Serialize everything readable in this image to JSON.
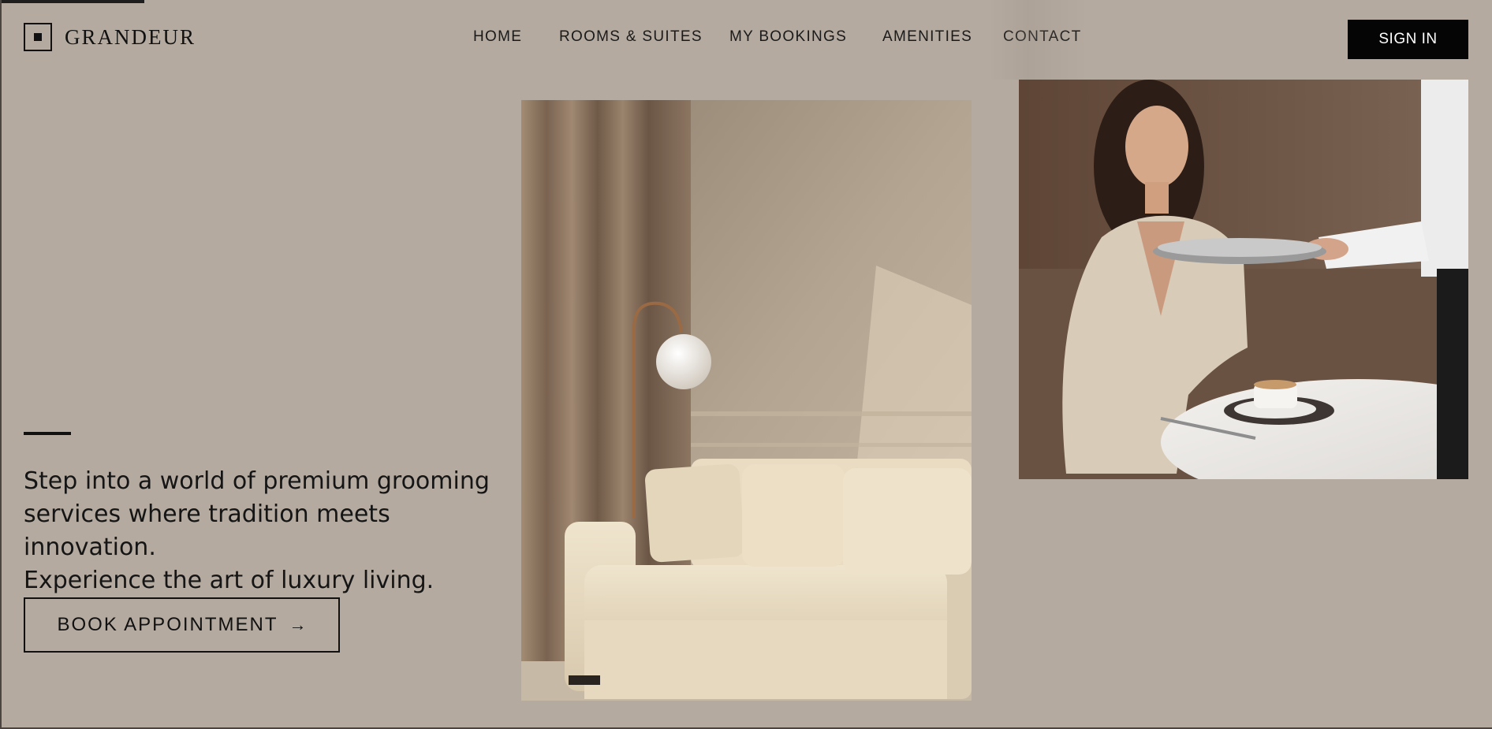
{
  "brand": {
    "name": "GRANDEUR",
    "accent": "#050505",
    "background": "#b4aaa0"
  },
  "nav": {
    "items": [
      "HOME",
      "ROOMS & SUITES",
      "MY BOOKINGS",
      "AMENITIES",
      "CONTACT"
    ],
    "signin_label": "SIGN IN"
  },
  "hero": {
    "tagline_lines": [
      "Step into a world of premium grooming",
      "services where tradition meets innovation.",
      "Experience the art of luxury living."
    ],
    "cta_label": "BOOK APPOINTMENT",
    "cta_icon": "arrow-right-icon"
  },
  "images": {
    "room": "hotel-room-sofa-photo",
    "service": "waiter-serving-guest-photo"
  }
}
